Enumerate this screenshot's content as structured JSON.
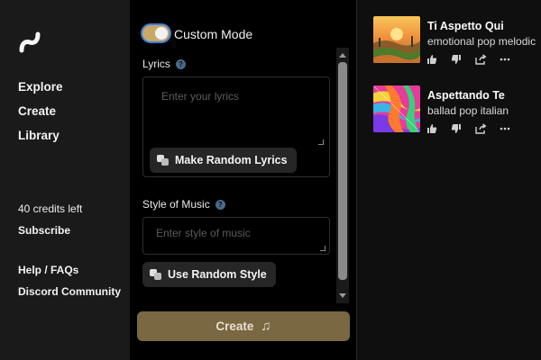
{
  "sidebar": {
    "nav": [
      "Explore",
      "Create",
      "Library"
    ],
    "credits": "40 credits left",
    "subscribe": "Subscribe",
    "help": "Help / FAQs",
    "discord": "Discord Community"
  },
  "create_panel": {
    "custom_mode_label": "Custom Mode",
    "lyrics_label": "Lyrics",
    "lyrics_placeholder": "Enter your lyrics",
    "random_lyrics_button": "Make Random Lyrics",
    "style_label": "Style of Music",
    "style_placeholder": "Enter style of music",
    "random_style_button": "Use Random Style",
    "create_button": "Create"
  },
  "songs": [
    {
      "title": "Ti Aspetto Qui",
      "desc": "emotional pop melodic"
    },
    {
      "title": "Aspettando Te",
      "desc": "ballad pop italian"
    }
  ],
  "colors": {
    "accent_gold": "#c9a769",
    "create_button_bg": "#7a6842",
    "background": "#1a1a1a",
    "panel_bg": "#000000"
  }
}
